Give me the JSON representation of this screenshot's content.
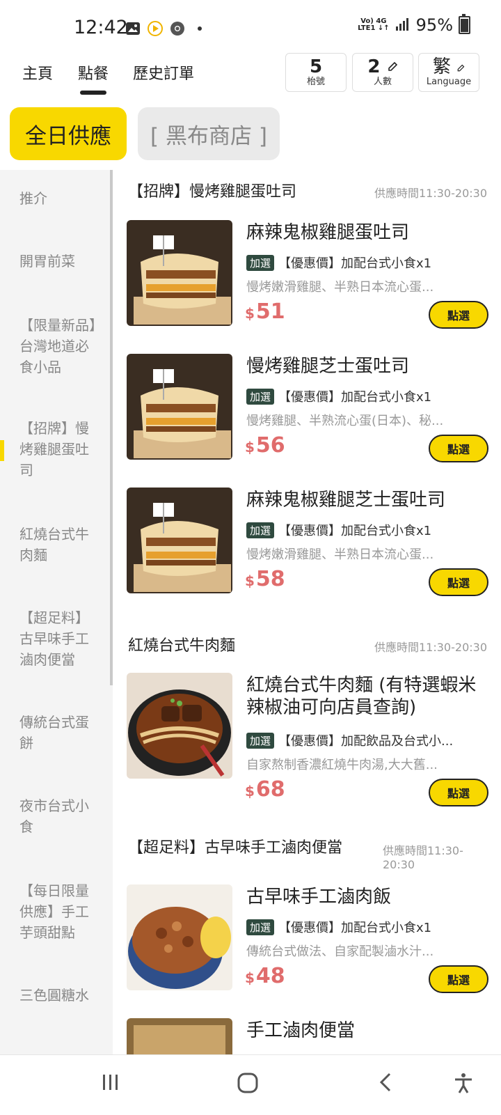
{
  "status_bar": {
    "time": "12:42",
    "net_top": "Vo) 4G",
    "net_bottom": "LTE1 ↓↑",
    "battery": "95%"
  },
  "top_nav": {
    "tabs": [
      {
        "label": "主頁"
      },
      {
        "label": "點餐"
      },
      {
        "label": "歷史訂單"
      }
    ],
    "table_no": {
      "value": "5",
      "label": "枱號"
    },
    "people": {
      "value": "2",
      "label": "人數"
    },
    "language": {
      "value": "繁",
      "label": "Language"
    }
  },
  "store_tabs": [
    "全日供應",
    "[ 黑布商店 ]"
  ],
  "sidebar": {
    "categories": [
      "推介",
      "開胃前菜",
      "【限量新品】台灣地道必食小品",
      "【招牌】慢烤雞腿蛋吐司",
      "紅燒台式牛肉麵",
      "【超足料】古早味手工滷肉便當",
      "傳統台式蛋餅",
      "夜市台式小食",
      "【每日限量供應】手工芋頭甜點",
      "三色圓糖水"
    ]
  },
  "sections": [
    {
      "title": "【招牌】慢烤雞腿蛋吐司",
      "time": "供應時間11:30-20:30",
      "items": [
        {
          "name": "麻辣鬼椒雞腿蛋吐司",
          "tag": "加選",
          "promo": "【優惠價】加配台式小食x1",
          "desc": "慢烤嫩滑雞腿、半熟日本流心蛋...",
          "currency": "$",
          "price": "51",
          "button": "點選"
        },
        {
          "name": "慢烤雞腿芝士蛋吐司",
          "tag": "加選",
          "promo": "【優惠價】加配台式小食x1",
          "desc": "慢烤雞腿、半熟流心蛋(日本)、秘...",
          "currency": "$",
          "price": "56",
          "button": "點選"
        },
        {
          "name": "麻辣鬼椒雞腿芝士蛋吐司",
          "tag": "加選",
          "promo": "【優惠價】加配台式小食x1",
          "desc": "慢烤嫩滑雞腿、半熟日本流心蛋...",
          "currency": "$",
          "price": "58",
          "button": "點選"
        }
      ]
    },
    {
      "title": "紅燒台式牛肉麵",
      "time": "供應時間11:30-20:30",
      "items": [
        {
          "name": "紅燒台式牛肉麵 (有特選蝦米辣椒油可向店員查詢)",
          "tag": "加選",
          "promo": "【優惠價】加配飲品及台式小...",
          "desc": "自家熬制香濃紅燒牛肉湯,大大舊...",
          "currency": "$",
          "price": "68",
          "button": "點選"
        }
      ]
    },
    {
      "title": "【超足料】古早味手工滷肉便當",
      "time": "供應時間11:30-20:30",
      "items": [
        {
          "name": "古早味手工滷肉飯",
          "tag": "加選",
          "promo": "【優惠價】加配台式小食x1",
          "desc": "傳統台式做法、自家配製滷水汁...",
          "currency": "$",
          "price": "48",
          "button": "點選"
        },
        {
          "name": "手工滷肉便當"
        }
      ]
    }
  ],
  "colors": {
    "accent": "#f8d800",
    "price": "#e06c6c",
    "tag_bg": "#2f4a3f"
  }
}
